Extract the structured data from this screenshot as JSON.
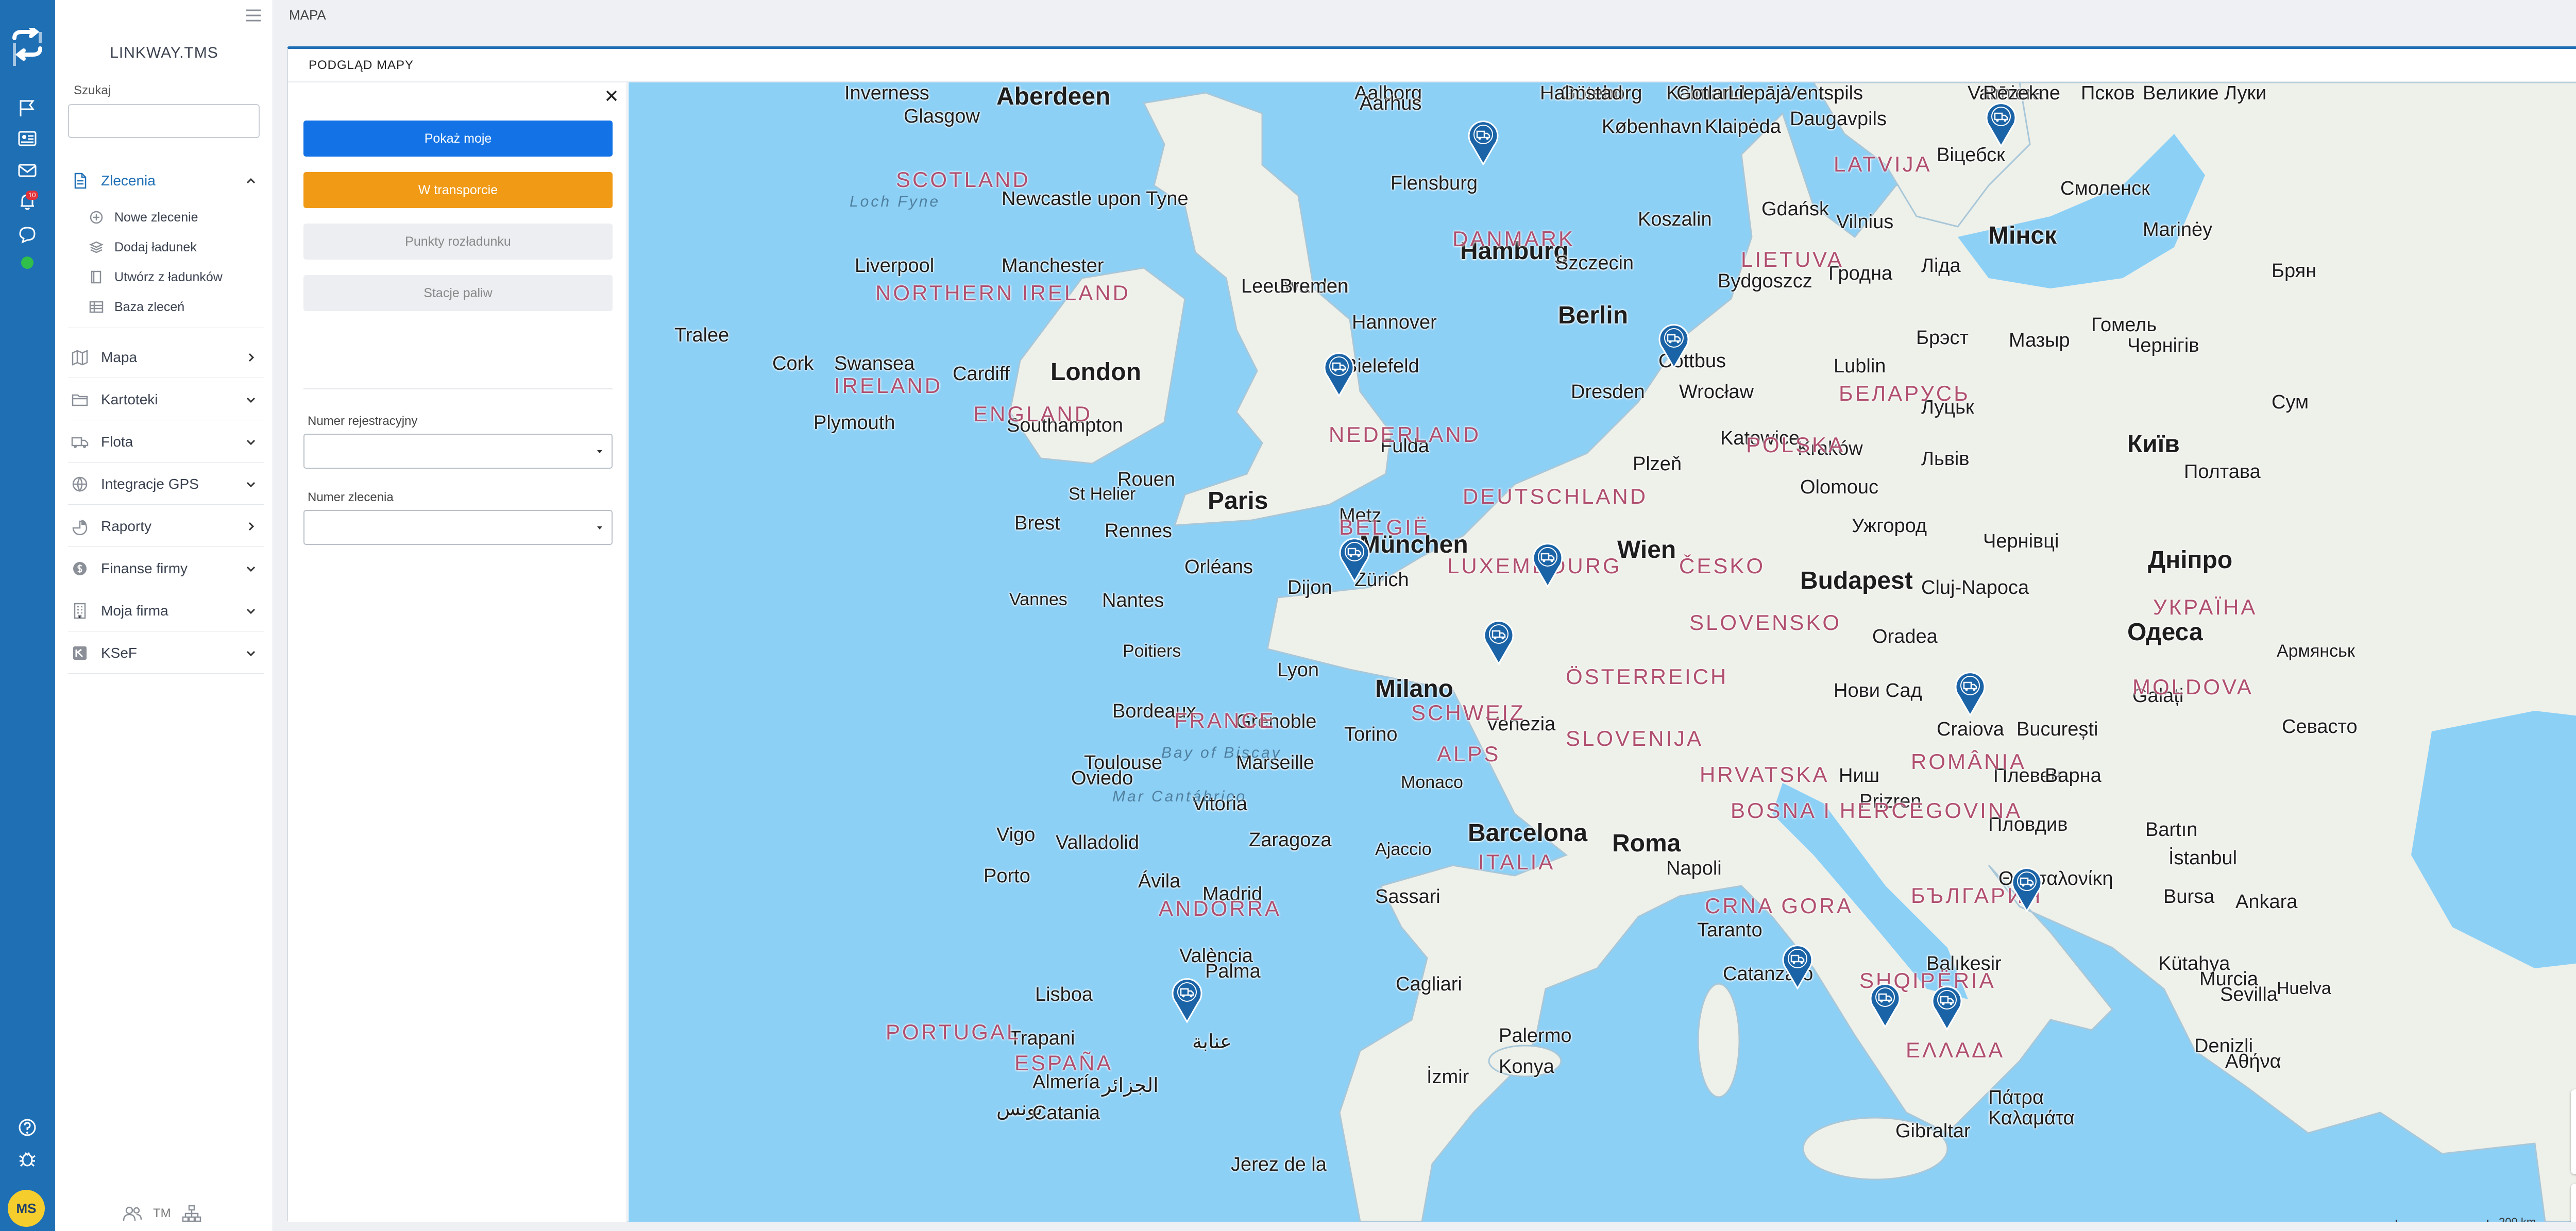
{
  "app": {
    "brand": "LINKWAY.TMS",
    "avatar_initials": "MS",
    "notification_badge": "10",
    "accent_color": "#1f6fb5"
  },
  "search": {
    "label": "Szukaj",
    "placeholder": ""
  },
  "nav": {
    "sections": [
      {
        "label": "Zlecenia",
        "icon": "document-icon",
        "expanded": true
      },
      {
        "label": "Mapa",
        "icon": "map-icon"
      },
      {
        "label": "Kartoteki",
        "icon": "folder-icon"
      },
      {
        "label": "Flota",
        "icon": "truck-icon"
      },
      {
        "label": "Integracje GPS",
        "icon": "globe-icon"
      },
      {
        "label": "Raporty",
        "icon": "chart-icon"
      },
      {
        "label": "Finanse firmy",
        "icon": "finance-icon"
      },
      {
        "label": "Moja firma",
        "icon": "building-icon"
      },
      {
        "label": "KSeF",
        "icon": "ksef-icon"
      }
    ],
    "zlecenia_items": [
      {
        "label": "Nowe zlecenie",
        "icon": "plus-circle-icon"
      },
      {
        "label": "Dodaj ładunek",
        "icon": "stack-icon"
      },
      {
        "label": "Utwórz z ładunków",
        "icon": "copy-icon"
      },
      {
        "label": "Baza zleceń",
        "icon": "table-icon"
      }
    ],
    "footer_text": "TM"
  },
  "topbar": {
    "breadcrumb": "MAPA"
  },
  "card": {
    "title": "PODGLĄD MAPY"
  },
  "filters": {
    "show_mine": "Pokaż moje",
    "in_transport": "W transporcie",
    "unloading_points": "Punkty rozładunku",
    "fuel_stations": "Stacje paliw",
    "registration_label": "Numer rejestracyjny",
    "registration_value": "",
    "order_label": "Numer zlecenia",
    "order_value": ""
  },
  "map": {
    "cities": [
      "Aberdeen",
      "Inverness",
      "Glasgow",
      "Newcastle upon Tyne",
      "Liverpool",
      "Manchester",
      "Cork",
      "Tralee",
      "Swansea",
      "Cardiff",
      "London",
      "Plymouth",
      "Southampton",
      "Aalborg",
      "Aarhus",
      "Göteborg",
      "Halmstad",
      "Kalmar",
      "København",
      "Gotland",
      "Ventspils",
      "Valmiera",
      "Псков",
      "Liepāja",
      "Rēzekne",
      "Великие Луки",
      "Klaipėda",
      "Daugavpils",
      "Вiцебск",
      "Смоленск",
      "Flensburg",
      "Koszalin",
      "Gdańsk",
      "Vilnius",
      "Мінск",
      "Marinėy",
      "Hamburg",
      "Szczecin",
      "Bydgoszcz",
      "Гродна",
      "Ліда",
      "Брян",
      "Leeuwarden",
      "Bremen",
      "Hannover",
      "Berlin",
      "Брэст",
      "Мазыр",
      "Гомель",
      "Чернігів",
      "Bielefeld",
      "Cottbus",
      "Lublin",
      "Dresden",
      "Wrocław",
      "Луцьк",
      "Сум",
      "Katowice",
      "Kraków",
      "Львів",
      "Київ",
      "Fulda",
      "Plzeň",
      "Olomouc",
      "Полтава",
      "Rouen",
      "Paris",
      "St Helier",
      "Brest",
      "Rennes",
      "Metz",
      "München",
      "Wien",
      "Ужгород",
      "Чернівці",
      "Дніпро",
      "Orléans",
      "Dijon",
      "Zürich",
      "Budapest",
      "Cluj-Napoca",
      "Vannes",
      "Nantes",
      "Poitiers",
      "Oradea",
      "Одеса",
      "Lyon",
      "Milano",
      "Нови Сад",
      "Galați",
      "Армянськ",
      "Bordeaux",
      "Grenoble",
      "Torino",
      "Venezia",
      "Craiova",
      "București",
      "Севасто",
      "Toulouse",
      "Marseille",
      "Monaco",
      "Ниш",
      "Плевен",
      "Варна",
      "Oviedo",
      "Vitoria",
      "Zaragoza",
      "Barcelona",
      "Prizren",
      "Пловдив",
      "Vigo",
      "Valladolid",
      "Porto",
      "Ávila",
      "Madrid",
      "Ajaccio",
      "Roma",
      "Napoli",
      "Bartın",
      "İstanbul",
      "Sassari",
      "Taranto",
      "Θεσσαλονίκη",
      "Bursa",
      "Ankara",
      "Lisboa",
      "València",
      "Palma",
      "Cagliari",
      "Catanzaro",
      "Balıkesir",
      "Kütahya",
      "Murcia",
      "Trapani",
      "Palermo",
      "İzmir",
      "Konya",
      "Huelva",
      "Sevilla",
      "Almería",
      "الجزائر",
      "عنابة",
      "تونس",
      "Catania",
      "Πάτρα",
      "Αθήνα",
      "Denizli",
      "Jerez de la",
      "Gibraltar",
      "Καλαμάτα"
    ],
    "countries": [
      "SCOTLAND",
      "NORTHERN IRELAND",
      "IRELAND",
      "ENGLAND",
      "DANMARK",
      "LATVIJA",
      "LIETUVA",
      "БЕЛАРУСЬ",
      "NEDERLAND",
      "POLSKA",
      "DEUTSCHLAND",
      "BELGIË",
      "LUXEMBOURG",
      "ČESKO",
      "SLOVENSKO",
      "УКРАЇНА",
      "ÖSTERREICH",
      "FRANCE",
      "SCHWEIZ",
      "MOLDOVA",
      "SLOVENIJA",
      "HRVATSKA",
      "ROMÂNIA",
      "BOSNA I HERCEGOVINA",
      "ITALIA",
      "CRNA GORA",
      "БЪЛГАРИЯ",
      "ANDORRA",
      "SHQIPËRIA",
      "PORTUGAL",
      "ESPAÑA",
      "ΕΛΛΑΔΑ",
      "ALPS"
    ],
    "seas": [
      "Loch Fyne",
      "Bay of Biscay",
      "Mar Cantábrico"
    ],
    "markers": [
      "truck-marker-icon",
      "truck-marker-icon",
      "truck-marker-icon",
      "truck-marker-icon",
      "truck-marker-icon",
      "truck-marker-icon",
      "truck-marker-icon",
      "truck-marker-icon",
      "truck-marker-icon",
      "truck-marker-icon",
      "truck-marker-icon",
      "truck-marker-icon",
      "truck-marker-icon"
    ],
    "zoom_in": "+",
    "zoom_out": "−",
    "scale_label": "200 km",
    "terms": "Terms of use",
    "copyright": "© 1987–2026 HERE",
    "sea_color": "#8dd0f6",
    "land_color": "#eef0ea"
  }
}
